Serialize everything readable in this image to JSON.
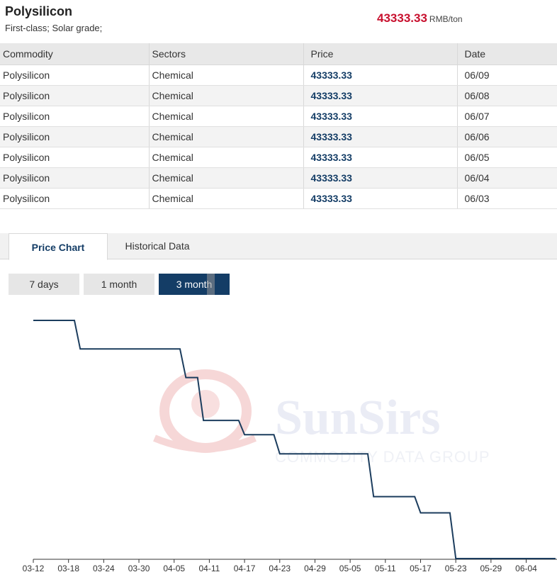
{
  "header": {
    "title": "Polysilicon",
    "subtitle": "First-class; Solar grade;",
    "price": "43333.33",
    "unit": "RMB/ton"
  },
  "table": {
    "columns": [
      "Commodity",
      "Sectors",
      "Price",
      "Date"
    ],
    "rows": [
      {
        "commodity": "Polysilicon",
        "sector": "Chemical",
        "price": "43333.33",
        "date": "06/09"
      },
      {
        "commodity": "Polysilicon",
        "sector": "Chemical",
        "price": "43333.33",
        "date": "06/08"
      },
      {
        "commodity": "Polysilicon",
        "sector": "Chemical",
        "price": "43333.33",
        "date": "06/07"
      },
      {
        "commodity": "Polysilicon",
        "sector": "Chemical",
        "price": "43333.33",
        "date": "06/06"
      },
      {
        "commodity": "Polysilicon",
        "sector": "Chemical",
        "price": "43333.33",
        "date": "06/05"
      },
      {
        "commodity": "Polysilicon",
        "sector": "Chemical",
        "price": "43333.33",
        "date": "06/04"
      },
      {
        "commodity": "Polysilicon",
        "sector": "Chemical",
        "price": "43333.33",
        "date": "06/03"
      }
    ]
  },
  "tabs": {
    "price_chart": "Price Chart",
    "historical_data": "Historical Data"
  },
  "ranges": {
    "days7": "7 days",
    "month1": "1 month",
    "month3": "3 month",
    "active": "3 month"
  },
  "watermark": {
    "brand": "SunSirs",
    "tagline": "COMMODITY DATA GROUP"
  },
  "colors": {
    "accent": "#143d66",
    "price_red": "#c8102e",
    "line": "#1c3d5e",
    "watermark_red": "#e8a0a0",
    "watermark_blue": "#c8cfe0"
  },
  "chart_data": {
    "type": "line",
    "x_ticks": [
      "03-12",
      "03-18",
      "03-24",
      "03-30",
      "04-05",
      "04-11",
      "04-17",
      "04-23",
      "04-29",
      "05-05",
      "05-11",
      "05-17",
      "05-23",
      "05-29",
      "06-04"
    ],
    "tick_day_index": [
      0,
      6,
      12,
      18,
      24,
      30,
      36,
      42,
      48,
      54,
      60,
      66,
      72,
      78,
      84
    ],
    "x": [
      "03-12",
      "03-19",
      "03-20",
      "04-06",
      "04-07",
      "04-09",
      "04-10",
      "04-16",
      "04-17",
      "04-22",
      "04-23",
      "05-08",
      "05-09",
      "05-16",
      "05-17",
      "05-22",
      "05-23",
      "06-09"
    ],
    "x_day_index": [
      0,
      7,
      8,
      25,
      26,
      28,
      29,
      35,
      36,
      41,
      42,
      57,
      58,
      65,
      66,
      71,
      72,
      89
    ],
    "values": [
      76667,
      76667,
      71667,
      71667,
      66667,
      66667,
      59167,
      59167,
      56667,
      56667,
      53333,
      53333,
      45833,
      45833,
      43000,
      43000,
      35000,
      35000
    ],
    "ylim": [
      35000,
      76667
    ],
    "grid": false,
    "legend": "none"
  }
}
